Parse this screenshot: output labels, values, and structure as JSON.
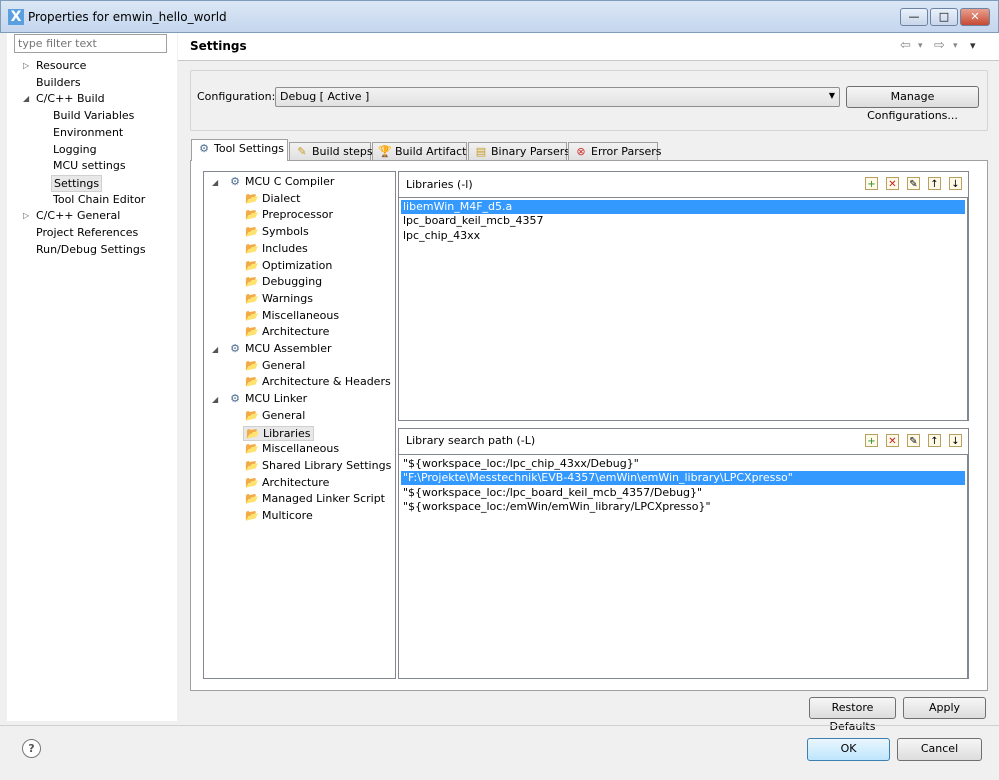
{
  "window": {
    "title": "Properties for emwin_hello_world",
    "minimize": "—",
    "maximize": "□",
    "close": "✕"
  },
  "filter": {
    "placeholder": "type filter text"
  },
  "nav_tree": [
    {
      "label": "Resource",
      "twisty": "▷",
      "level": 0
    },
    {
      "label": "Builders",
      "twisty": "",
      "level": 0
    },
    {
      "label": "C/C++ Build",
      "twisty": "◢",
      "level": 0
    },
    {
      "label": "Build Variables",
      "twisty": "",
      "level": 1
    },
    {
      "label": "Environment",
      "twisty": "",
      "level": 1
    },
    {
      "label": "Logging",
      "twisty": "",
      "level": 1
    },
    {
      "label": "MCU settings",
      "twisty": "",
      "level": 1
    },
    {
      "label": "Settings",
      "twisty": "",
      "level": 1,
      "selected": true
    },
    {
      "label": "Tool Chain Editor",
      "twisty": "",
      "level": 1
    },
    {
      "label": "C/C++ General",
      "twisty": "▷",
      "level": 0
    },
    {
      "label": "Project References",
      "twisty": "",
      "level": 0
    },
    {
      "label": "Run/Debug Settings",
      "twisty": "",
      "level": 0
    }
  ],
  "header": {
    "title": "Settings",
    "back": "⇦",
    "forward": "⇨",
    "menu": "▾"
  },
  "configuration": {
    "label": "Configuration:",
    "value": "Debug  [ Active ]",
    "manage_button": "Manage Configurations..."
  },
  "tabs": [
    {
      "label": "Tool Settings",
      "icon": "gear-icon",
      "glyph": "⚙",
      "active": true
    },
    {
      "label": "Build steps",
      "icon": "wand-icon",
      "glyph": "✎"
    },
    {
      "label": "Build Artifact",
      "icon": "trophy-icon",
      "glyph": "🏆"
    },
    {
      "label": "Binary Parsers",
      "icon": "binary-icon",
      "glyph": "▤"
    },
    {
      "label": "Error Parsers",
      "icon": "error-icon",
      "glyph": "⊗"
    }
  ],
  "tool_tree": [
    {
      "label": "MCU C Compiler",
      "type": "tool"
    },
    {
      "label": "Dialect",
      "type": "option"
    },
    {
      "label": "Preprocessor",
      "type": "option"
    },
    {
      "label": "Symbols",
      "type": "option"
    },
    {
      "label": "Includes",
      "type": "option"
    },
    {
      "label": "Optimization",
      "type": "option"
    },
    {
      "label": "Debugging",
      "type": "option"
    },
    {
      "label": "Warnings",
      "type": "option"
    },
    {
      "label": "Miscellaneous",
      "type": "option"
    },
    {
      "label": "Architecture",
      "type": "option"
    },
    {
      "label": "MCU Assembler",
      "type": "tool"
    },
    {
      "label": "General",
      "type": "option"
    },
    {
      "label": "Architecture & Headers",
      "type": "option"
    },
    {
      "label": "MCU Linker",
      "type": "tool"
    },
    {
      "label": "General",
      "type": "option"
    },
    {
      "label": "Libraries",
      "type": "option",
      "selected": true
    },
    {
      "label": "Miscellaneous",
      "type": "option"
    },
    {
      "label": "Shared Library Settings",
      "type": "option"
    },
    {
      "label": "Architecture",
      "type": "option"
    },
    {
      "label": "Managed Linker Script",
      "type": "option"
    },
    {
      "label": "Multicore",
      "type": "option"
    }
  ],
  "libraries": {
    "title": "Libraries (-l)",
    "items": [
      "libemWin_M4F_d5.a",
      "lpc_board_keil_mcb_4357",
      "lpc_chip_43xx"
    ],
    "selected": 0
  },
  "search_path": {
    "title": "Library search path (-L)",
    "items": [
      "\"${workspace_loc:/lpc_chip_43xx/Debug}\"",
      "\"F:\\Projekte\\Messtechnik\\EVB-4357\\emWin\\emWin_library\\LPCXpresso\"",
      "\"${workspace_loc:/lpc_board_keil_mcb_4357/Debug}\"",
      "\"${workspace_loc:/emWin/emWin_library/LPCXpresso}\""
    ],
    "selected": 1
  },
  "list_toolbar": [
    {
      "icon": "add-icon",
      "glyph": "+"
    },
    {
      "icon": "delete-icon",
      "glyph": "✕"
    },
    {
      "icon": "edit-icon",
      "glyph": "✎"
    },
    {
      "icon": "move-up-icon",
      "glyph": "↑"
    },
    {
      "icon": "move-down-icon",
      "glyph": "↓"
    }
  ],
  "buttons": {
    "restore": "Restore Defaults",
    "apply": "Apply",
    "ok": "OK",
    "cancel": "Cancel",
    "help": "?"
  },
  "colors": {
    "selection": "#3399ff"
  }
}
